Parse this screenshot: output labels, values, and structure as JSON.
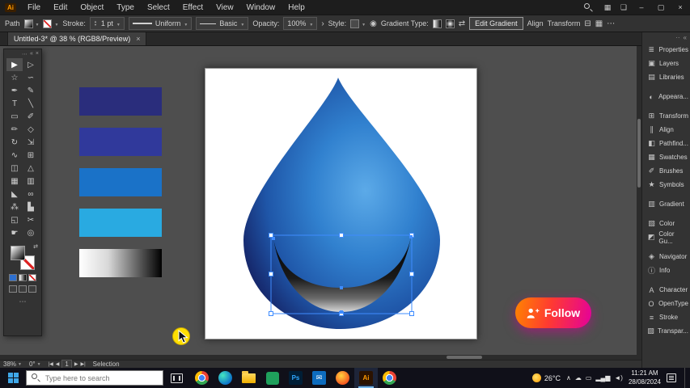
{
  "menubar": {
    "app_badge": "Ai",
    "items": [
      "File",
      "Edit",
      "Object",
      "Type",
      "Select",
      "Effect",
      "View",
      "Window",
      "Help"
    ],
    "icons": {
      "workspace": "▦",
      "arrange": "❏"
    },
    "window_controls": {
      "minimize": "–",
      "maximize": "▢",
      "close": "×"
    }
  },
  "controlbar": {
    "object_label": "Path",
    "stroke_label": "Stroke:",
    "stroke_value": "1 pt",
    "variable_width_value": "Uniform",
    "brush_value": "Basic",
    "opacity_label": "Opacity:",
    "opacity_value": "100%",
    "style_label": "Style:",
    "gradient_type_label": "Gradient Type:",
    "edit_gradient_label": "Edit Gradient",
    "align_label": "Align",
    "transform_label": "Transform",
    "icons": {
      "more": "›",
      "recolor": "◉",
      "reverse": "⇄",
      "isolate": "⊟",
      "grid": "▦",
      "ellipsis": "⋯"
    }
  },
  "document": {
    "tab_title": "Untitled-3* @ 38 % (RGB8/Preview)",
    "close_glyph": "×"
  },
  "toolbar": {
    "header": {
      "drag": "⋯",
      "collapse": "«",
      "close": "×"
    },
    "icons": {
      "swap": "⇄",
      "more": "⋯"
    },
    "tools": [
      {
        "name": "selection",
        "glyph": "▶",
        "active": true
      },
      {
        "name": "direct-selection",
        "glyph": "▷"
      },
      {
        "name": "magic-wand",
        "glyph": "☆"
      },
      {
        "name": "lasso",
        "glyph": "∽"
      },
      {
        "name": "pen",
        "glyph": "✒"
      },
      {
        "name": "curvature",
        "glyph": "✎"
      },
      {
        "name": "type",
        "glyph": "T"
      },
      {
        "name": "line-segment",
        "glyph": "╲"
      },
      {
        "name": "rectangle",
        "glyph": "▭"
      },
      {
        "name": "paintbrush",
        "glyph": "✐"
      },
      {
        "name": "pencil",
        "glyph": "✏"
      },
      {
        "name": "shaper",
        "glyph": "◇"
      },
      {
        "name": "rotate",
        "glyph": "↻"
      },
      {
        "name": "scale",
        "glyph": "⇲"
      },
      {
        "name": "width",
        "glyph": "∿"
      },
      {
        "name": "free-transform",
        "glyph": "⊞"
      },
      {
        "name": "shape-builder",
        "glyph": "◫"
      },
      {
        "name": "perspective-grid",
        "glyph": "△"
      },
      {
        "name": "mesh",
        "glyph": "▦"
      },
      {
        "name": "gradient",
        "glyph": "▥"
      },
      {
        "name": "eyedropper",
        "glyph": "◣"
      },
      {
        "name": "blend",
        "glyph": "∞"
      },
      {
        "name": "symbol-sprayer",
        "glyph": "⁂"
      },
      {
        "name": "column-graph",
        "glyph": "▙"
      },
      {
        "name": "artboard",
        "glyph": "◱"
      },
      {
        "name": "slice",
        "glyph": "✂"
      },
      {
        "name": "hand",
        "glyph": "☛"
      },
      {
        "name": "zoom",
        "glyph": "◎"
      }
    ]
  },
  "canvas": {
    "swatches": [
      {
        "name": "dark-navy",
        "css": "#2a2d7c"
      },
      {
        "name": "navy",
        "css": "#30399b"
      },
      {
        "name": "blue",
        "css": "#1a72c8"
      },
      {
        "name": "light-blue",
        "css": "#29aae1"
      },
      {
        "name": "bw-gradient",
        "css": "linear-gradient(90deg,#ffffff 0%,#d8d8d8 35%,#000000 100%)"
      }
    ],
    "artwork": {
      "drop_gradient": [
        "#5caae8",
        "#3181cf",
        "#1f56a8",
        "#141f60"
      ],
      "crescent_gradient": [
        "#000000",
        "#1a1a1a",
        "#6a6a6a",
        "#d8d8d8"
      ],
      "selection_color": "#3f8cff"
    }
  },
  "follow_overlay": {
    "label": "Follow",
    "color_left": "#ff8400",
    "color_mid": "#ff3b30",
    "color_right": "#e4009b"
  },
  "rightpanel": {
    "header": {
      "options": "··",
      "collapse": "«"
    },
    "groups": [
      [
        {
          "label": "Properties",
          "glyph": "≣"
        },
        {
          "label": "Layers",
          "glyph": "▣"
        },
        {
          "label": "Libraries",
          "glyph": "▤"
        }
      ],
      [
        {
          "label": "Appeara...",
          "glyph": "◐"
        }
      ],
      [
        {
          "label": "Transform",
          "glyph": "⊞"
        },
        {
          "label": "Align",
          "glyph": "∥"
        },
        {
          "label": "Pathfind...",
          "glyph": "◧"
        },
        {
          "label": "Swatches",
          "glyph": "▦"
        },
        {
          "label": "Brushes",
          "glyph": "✐"
        },
        {
          "label": "Symbols",
          "glyph": "★"
        }
      ],
      [
        {
          "label": "Gradient",
          "glyph": "▥"
        }
      ],
      [
        {
          "label": "Color",
          "glyph": "▧"
        },
        {
          "label": "Color Gu...",
          "glyph": "◩"
        }
      ],
      [
        {
          "label": "Navigator",
          "glyph": "◈"
        },
        {
          "label": "Info",
          "glyph": "ⓘ"
        }
      ],
      [
        {
          "label": "Character",
          "glyph": "A"
        },
        {
          "label": "OpenType",
          "glyph": "O"
        },
        {
          "label": "Stroke",
          "glyph": "≡"
        },
        {
          "label": "Transpar...",
          "glyph": "▨"
        }
      ]
    ]
  },
  "statusbar": {
    "zoom": "38%",
    "rotation": "0°",
    "artboard_number": "1",
    "status": "Selection",
    "nav": {
      "first": "|◀",
      "prev": "◀",
      "next": "▶",
      "last": "▶|"
    }
  },
  "taskbar": {
    "search_placeholder": "Type here to search",
    "apps": [
      {
        "name": "chrome",
        "kind": "chrome"
      },
      {
        "name": "edge",
        "kind": "edge"
      },
      {
        "name": "file-explorer",
        "kind": "folder"
      },
      {
        "name": "green-app",
        "kind": "green"
      },
      {
        "name": "photoshop",
        "kind": "ps",
        "label": "Ps"
      },
      {
        "name": "mail",
        "kind": "mail",
        "glyph": "✉"
      },
      {
        "name": "orange-app",
        "kind": "orange"
      },
      {
        "name": "illustrator",
        "kind": "ai",
        "label": "Ai",
        "active": true
      },
      {
        "name": "browser",
        "kind": "chrome"
      }
    ],
    "tray": {
      "temperature": "26°C",
      "icons": [
        {
          "name": "chevron-up-icon",
          "glyph": "∧"
        },
        {
          "name": "cloud-icon",
          "glyph": "☁"
        },
        {
          "name": "battery-icon",
          "glyph": "▭"
        },
        {
          "name": "signal-icon",
          "glyph": "▂▄▆"
        },
        {
          "name": "volume-icon",
          "glyph": "◄)"
        }
      ],
      "time": "11:21 AM",
      "date": "28/08/2024"
    }
  }
}
